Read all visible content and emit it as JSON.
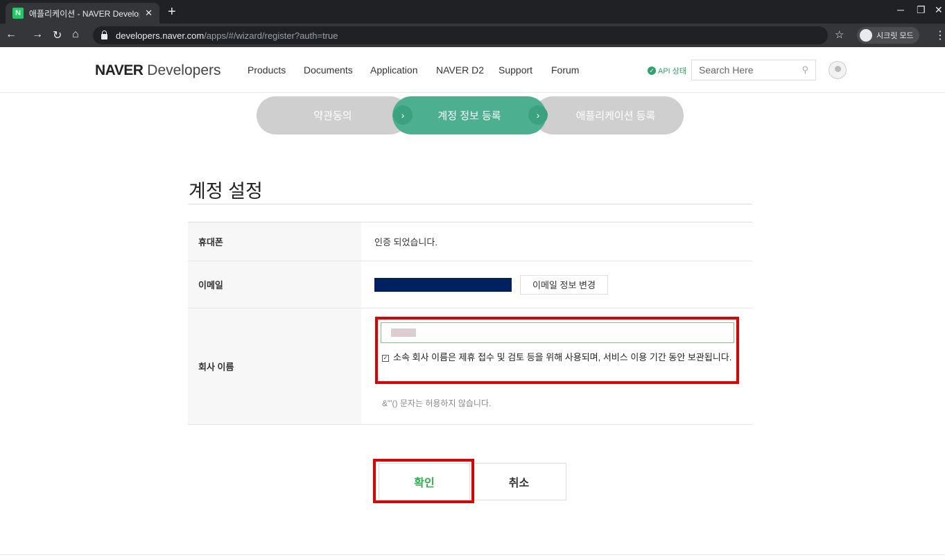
{
  "browser": {
    "tab_title": "애플리케이션 - NAVER Develop",
    "favicon_letter": "N",
    "url_domain": "developers.naver.com",
    "url_path": "/apps/#/wizard/register?auth=true",
    "incognito_label": "시크릿 모드"
  },
  "header": {
    "logo_bold": "NAVER",
    "logo_light": " Developers",
    "nav": [
      "Products",
      "Documents",
      "Application",
      "NAVER D2",
      "Support",
      "Forum"
    ],
    "api_status": "API 상태",
    "search_placeholder": "Search Here"
  },
  "steps": {
    "step1": "약관동의",
    "step2": "계정 정보 등록",
    "step3": "애플리케이션 등록",
    "arrow": "›"
  },
  "form": {
    "title": "계정 설정",
    "phone_label": "휴대폰",
    "phone_value": "인증 되었습니다.",
    "email_label": "이메일",
    "email_change_button": "이메일 정보 변경",
    "company_label": "회사 이름",
    "company_consent": "소속 회사 이름은 제휴 접수 및 검토 등을 위해 사용되며, 서비스 이용 기간 동안 보관됩니다.",
    "company_notice": "&\"'() 문자는 허용하지 않습니다."
  },
  "buttons": {
    "confirm": "확인",
    "cancel": "취소"
  },
  "colors": {
    "accent_green": "#4caf8f",
    "highlight_red": "#e00000",
    "email_mask": "#002060"
  }
}
